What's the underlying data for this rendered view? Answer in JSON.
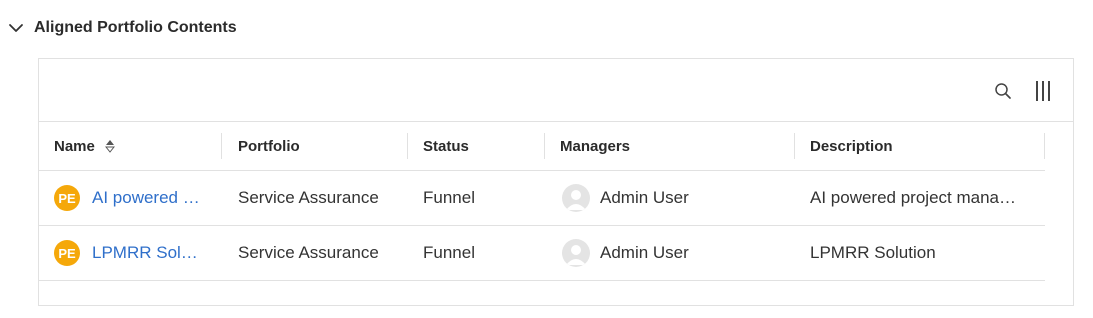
{
  "section": {
    "title": "Aligned Portfolio Contents",
    "expanded": true
  },
  "toolbar": {
    "search_icon": "search-icon",
    "columns_icon": "columns-icon"
  },
  "table": {
    "columns": {
      "name": "Name",
      "portfolio": "Portfolio",
      "status": "Status",
      "managers": "Managers",
      "description": "Description"
    },
    "rows": [
      {
        "badge": "PE",
        "name": "AI powered …",
        "portfolio": "Service Assurance",
        "status": "Funnel",
        "manager": "Admin User",
        "description": "AI powered project mana…"
      },
      {
        "badge": "PE",
        "name": "LPMRR Sol…",
        "portfolio": "Service Assurance",
        "status": "Funnel",
        "manager": "Admin User",
        "description": "LPMRR Solution"
      }
    ]
  },
  "colors": {
    "badge": "#f5a80a",
    "link": "#2f6fca",
    "border": "#e1e1e1"
  }
}
